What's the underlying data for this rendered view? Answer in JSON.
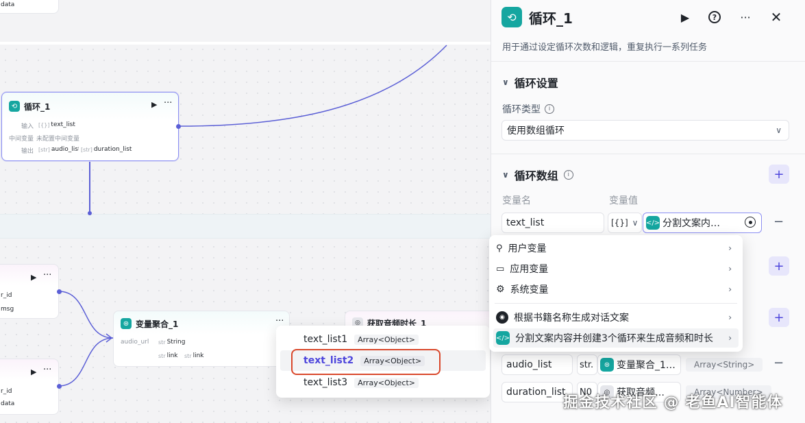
{
  "canvas": {
    "top_node_partial": {
      "label": "data"
    },
    "loop_node": {
      "title": "循环_1",
      "input_label": "输入",
      "input_chip": "text_list",
      "input_chip_type": "[{}]",
      "mid_label": "中间变量",
      "mid_value": "未配置中间变量",
      "output_label": "输出",
      "output_chip_1": "audio_list",
      "output_chip_2": "duration_list",
      "output_chip_type": "[str]"
    },
    "left_node_a": {
      "line1": "r_id",
      "line2": "msg"
    },
    "left_node_b": {
      "line1": "r_id",
      "line2": "data"
    },
    "agg_node": {
      "title": "变量聚合_1",
      "label": "audio_url",
      "chip_1": "String",
      "chip_2": "link",
      "chip_3": "link",
      "chip_type": "str"
    },
    "audio_node": {
      "title": "获取音频时长_1"
    },
    "var_popup": {
      "items": [
        {
          "name": "text_list1",
          "type": "Array<Object>"
        },
        {
          "name": "text_list2",
          "type": "Array<Object>"
        },
        {
          "name": "text_list3",
          "type": "Array<Object>"
        }
      ]
    }
  },
  "panel": {
    "title": "循环_1",
    "description": "用于通过设定循环次数和逻辑，重复执行一系列任务",
    "loop_settings": {
      "title": "循环设置",
      "type_label": "循环类型",
      "type_value": "使用数组循环"
    },
    "loop_array": {
      "title": "循环数组",
      "col_name": "变量名",
      "col_value": "变量值",
      "row_name": "text_list",
      "row_type_icon": "[{}]",
      "row_ref": "分割文案内…"
    },
    "outputs": [
      {
        "name": "audio_list",
        "type_icon": "str.",
        "ref": "变量聚合_1…",
        "type": "Array<String>"
      },
      {
        "name": "duration_list",
        "type_icon": "N0",
        "ref": "获取音频…",
        "type": "Array<Number>"
      }
    ]
  },
  "menu": {
    "items": [
      {
        "label": "用户变量",
        "icon": "user-icon"
      },
      {
        "label": "应用变量",
        "icon": "folder-icon"
      },
      {
        "label": "系统变量",
        "icon": "gear-icon"
      },
      {
        "label": "根据书籍名称生成对话文案",
        "icon": "bot-icon"
      },
      {
        "label": "分割文案内容并创建3个循环来生成音频和时长",
        "icon": "code-icon"
      }
    ]
  },
  "watermark": "掘金技术社区 @ 老鱼AI智能体"
}
